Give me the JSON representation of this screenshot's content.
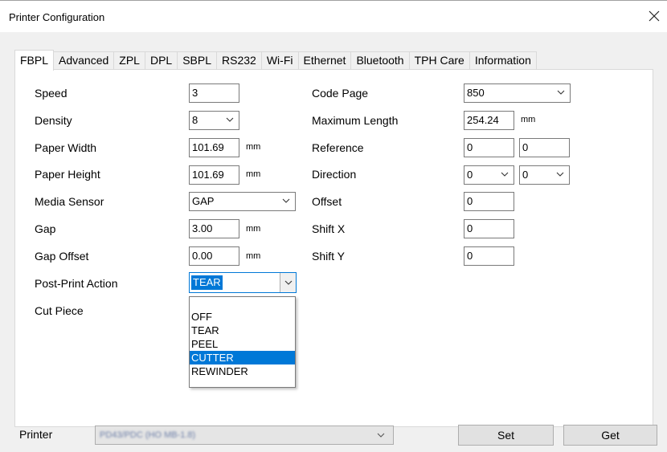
{
  "window": {
    "title": "Printer Configuration",
    "close_icon": "close-icon"
  },
  "tabs": [
    {
      "label": "FBPL",
      "active": true
    },
    {
      "label": "Advanced"
    },
    {
      "label": "ZPL"
    },
    {
      "label": "DPL"
    },
    {
      "label": "SBPL"
    },
    {
      "label": "RS232"
    },
    {
      "label": "Wi-Fi"
    },
    {
      "label": "Ethernet"
    },
    {
      "label": "Bluetooth"
    },
    {
      "label": "TPH Care"
    },
    {
      "label": "Information"
    }
  ],
  "fbpl": {
    "speed": {
      "label": "Speed",
      "value": "3"
    },
    "density": {
      "label": "Density",
      "value": "8"
    },
    "paper_width": {
      "label": "Paper Width",
      "value": "101.69",
      "unit": "mm"
    },
    "paper_height": {
      "label": "Paper Height",
      "value": "101.69",
      "unit": "mm"
    },
    "media_sensor": {
      "label": "Media Sensor",
      "value": "GAP"
    },
    "gap": {
      "label": "Gap",
      "value": "3.00",
      "unit": "mm"
    },
    "gap_offset": {
      "label": "Gap Offset",
      "value": "0.00",
      "unit": "mm"
    },
    "post_print_action": {
      "label": "Post-Print Action",
      "value": "TEAR",
      "options": [
        "OFF",
        "TEAR",
        "PEEL",
        "CUTTER",
        "REWINDER"
      ],
      "highlighted": "CUTTER"
    },
    "cut_piece": {
      "label": "Cut Piece"
    },
    "code_page": {
      "label": "Code Page",
      "value": "850"
    },
    "maximum_length": {
      "label": "Maximum Length",
      "value": "254.24",
      "unit": "mm"
    },
    "reference": {
      "label": "Reference",
      "x": "0",
      "y": "0"
    },
    "direction": {
      "label": "Direction",
      "a": "0",
      "b": "0"
    },
    "offset": {
      "label": "Offset",
      "value": "0"
    },
    "shift_x": {
      "label": "Shift X",
      "value": "0"
    },
    "shift_y": {
      "label": "Shift Y",
      "value": "0"
    }
  },
  "footer": {
    "printer_label": "Printer",
    "printer_value": "PD43/PDC (HO MB-1.8)",
    "set_button": "Set",
    "get_button": "Get"
  },
  "colors": {
    "accent": "#0078d7",
    "dialog_bg": "#f0f0f0",
    "panel_bg": "#ffffff"
  }
}
